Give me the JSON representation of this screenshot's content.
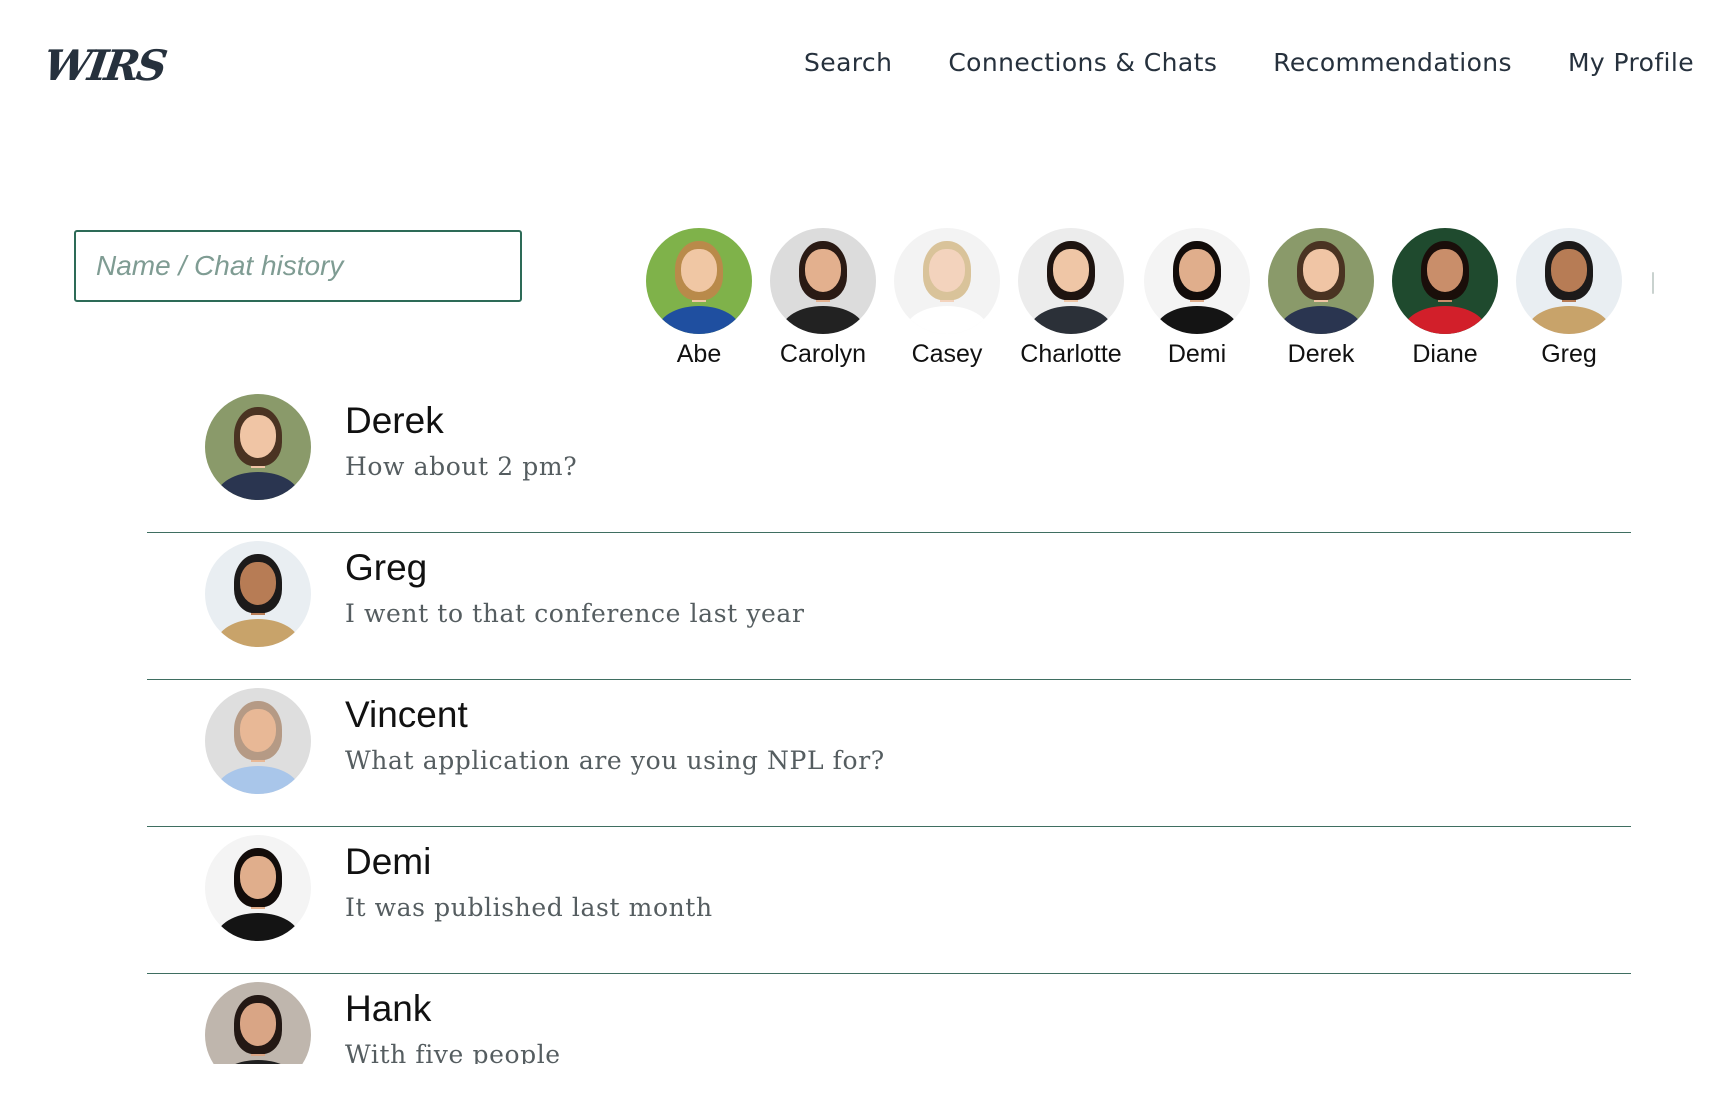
{
  "header": {
    "logo": "WIRS",
    "nav": [
      {
        "label": "Search"
      },
      {
        "label": "Connections & Chats"
      },
      {
        "label": "Recommendations"
      },
      {
        "label": "My Profile"
      }
    ]
  },
  "search": {
    "placeholder": "Name / Chat history",
    "value": ""
  },
  "connections": [
    {
      "name": "Abe",
      "bg": "#7fb24a",
      "hair": "#b98a4a",
      "skin": "#f0c7a4",
      "body": "#1f4fa0"
    },
    {
      "name": "Carolyn",
      "bg": "#dcdcdc",
      "hair": "#2a1a14",
      "skin": "#e3b08e",
      "body": "#222222"
    },
    {
      "name": "Casey",
      "bg": "#f3f3f3",
      "hair": "#d9c39a",
      "skin": "#f3d3bd",
      "body": "#ffffff"
    },
    {
      "name": "Charlotte",
      "bg": "#ececec",
      "hair": "#1e1410",
      "skin": "#efc6a6",
      "body": "#2b3038"
    },
    {
      "name": "Demi",
      "bg": "#f4f4f4",
      "hair": "#120c0a",
      "skin": "#e0ae8c",
      "body": "#141414"
    },
    {
      "name": "Derek",
      "bg": "#8a9a6a",
      "hair": "#4a3322",
      "skin": "#f0c5a5",
      "body": "#2a3550"
    },
    {
      "name": "Diane",
      "bg": "#1f4a2e",
      "hair": "#1a0e0a",
      "skin": "#c98e6a",
      "body": "#d21f2a"
    },
    {
      "name": "Greg",
      "bg": "#e9eef2",
      "hair": "#1c1a1a",
      "skin": "#b77c55",
      "body": "#c8a36a"
    }
  ],
  "chats": [
    {
      "name": "Derek",
      "message": "How about 2 pm?",
      "bg": "#8a9a6a",
      "hair": "#4a3322",
      "skin": "#f0c5a5",
      "body": "#2a3550"
    },
    {
      "name": "Greg",
      "message": "I went to that conference last year",
      "bg": "#e9eef2",
      "hair": "#1c1a1a",
      "skin": "#b77c55",
      "body": "#c8a36a"
    },
    {
      "name": "Vincent",
      "message": "What application are you using NPL for?",
      "bg": "#dedede",
      "hair": "#b59a85",
      "skin": "#e8b896",
      "body": "#a9c6ea"
    },
    {
      "name": "Demi",
      "message": "It was published last month",
      "bg": "#f4f4f4",
      "hair": "#120c0a",
      "skin": "#e0ae8c",
      "body": "#141414"
    },
    {
      "name": "Hank",
      "message": "With five people",
      "bg": "#bfb6ad",
      "hair": "#231814",
      "skin": "#d9a585",
      "body": "#1f1f1f"
    }
  ]
}
